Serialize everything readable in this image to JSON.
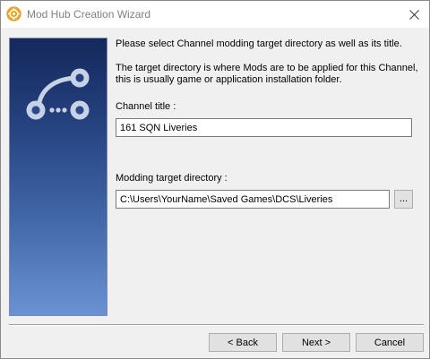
{
  "window": {
    "title": "Mod Hub Creation Wizard",
    "app_icon": "gear-icon",
    "close_icon": "close-icon",
    "accent_color": "#f0a020"
  },
  "side_panel": {
    "icon": "branch-nodes-icon",
    "gradient_top": "#14295c",
    "gradient_bottom": "#6a92d2"
  },
  "main": {
    "instruction": "Please select Channel modding target directory as well as its title.",
    "description_line1": "The target directory is where Mods are to be applied for this Channel,",
    "description_line2": "this is usually game or application installation folder.",
    "channel_title_label": "Channel title :",
    "channel_title_value": "161 SQN Liveries",
    "target_dir_label": "Modding target directory :",
    "target_dir_value": "C:\\Users\\YourName\\Saved Games\\DCS\\Liveries",
    "browse_label": "..."
  },
  "footer": {
    "back_label": "< Back",
    "next_label": "Next >",
    "cancel_label": "Cancel"
  }
}
